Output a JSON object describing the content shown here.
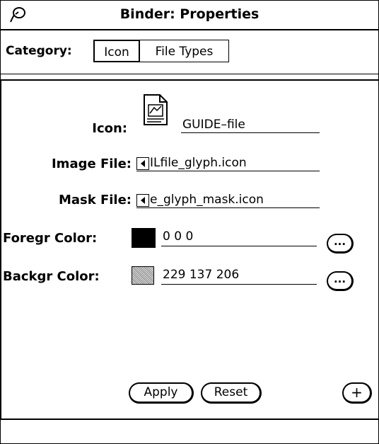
{
  "window": {
    "title": "Binder: Properties"
  },
  "category": {
    "label": "Category:",
    "options": [
      "Icon",
      "File Types"
    ],
    "selected": "Icon"
  },
  "icon_field": {
    "label": "Icon:",
    "value": "GUIDE–file"
  },
  "image_file": {
    "label": "Image File:",
    "value": "ILfile_glyph.icon"
  },
  "mask_file": {
    "label": "Mask File:",
    "value": "e_glyph_mask.icon"
  },
  "foreground": {
    "label": "Foregr Color:",
    "value": "0 0 0",
    "swatch_color": "#000000",
    "button_label": "..."
  },
  "background": {
    "label": "Backgr Color:",
    "value": "229 137 206",
    "swatch_color": "#e589ce",
    "button_label": "..."
  },
  "buttons": {
    "apply": "Apply",
    "reset": "Reset",
    "add": "+"
  },
  "icons": {
    "window_menu": "window-menu-icon",
    "document_preview": "guide-file-glyph-icon",
    "scroll_left": "scroll-left-arrow-icon"
  }
}
